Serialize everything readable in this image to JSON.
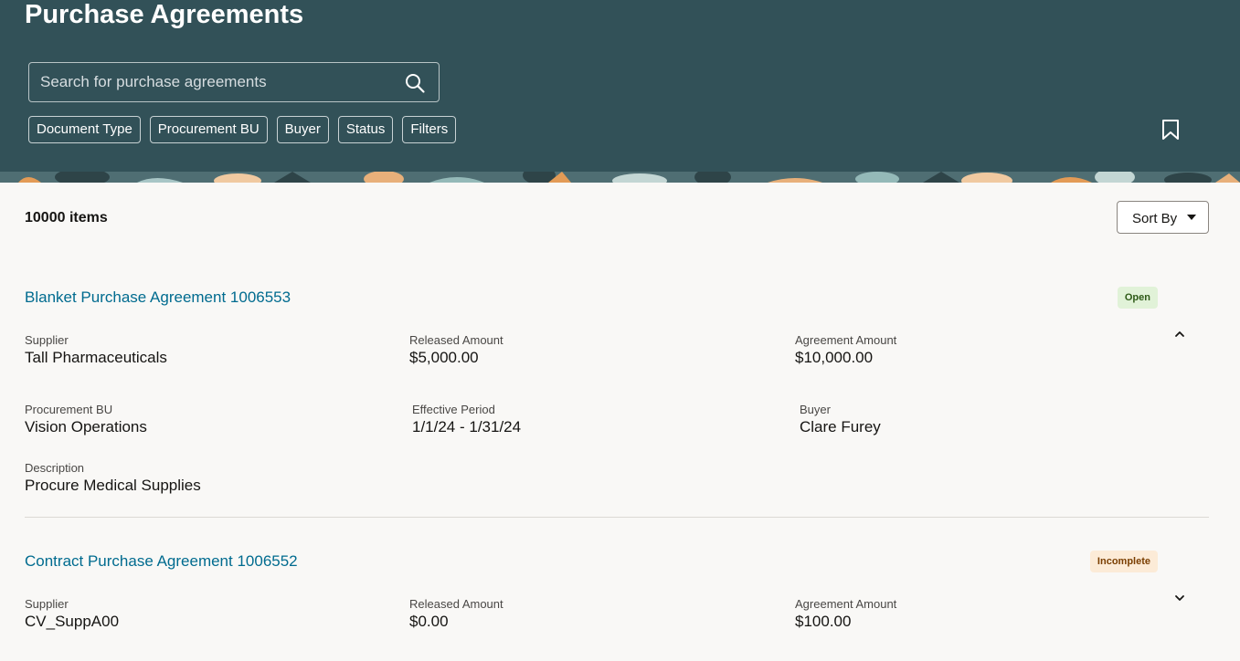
{
  "header": {
    "title": "Purchase Agreements",
    "search_placeholder": "Search for purchase agreements",
    "filters": [
      "Document Type",
      "Procurement BU",
      "Buyer",
      "Status",
      "Filters"
    ]
  },
  "toolbar": {
    "items_count": "10000 items",
    "sort_label": "Sort By"
  },
  "agreements": [
    {
      "title": "Blanket Purchase Agreement 1006553",
      "status": "Open",
      "expanded": true,
      "supplier_label": "Supplier",
      "supplier": "Tall Pharmaceuticals",
      "released_label": "Released Amount",
      "released": "$5,000.00",
      "agreement_label": "Agreement Amount",
      "agreement": "$10,000.00",
      "bu_label": "Procurement BU",
      "bu": "Vision Operations",
      "period_label": "Effective Period",
      "period": "1/1/24 - 1/31/24",
      "buyer_label": "Buyer",
      "buyer": "Clare Furey",
      "description_label": "Description",
      "description": "Procure Medical Supplies"
    },
    {
      "title": "Contract Purchase Agreement 1006552",
      "status": "Incomplete",
      "expanded": false,
      "supplier_label": "Supplier",
      "supplier": "CV_SuppA00",
      "released_label": "Released Amount",
      "released": "$0.00",
      "agreement_label": "Agreement Amount",
      "agreement": "$100.00"
    }
  ],
  "colors": {
    "header_bg": "#325158",
    "link": "#006b8f",
    "open_badge_bg": "#e1f2d8",
    "incomplete_badge_bg": "#fcebd7"
  }
}
